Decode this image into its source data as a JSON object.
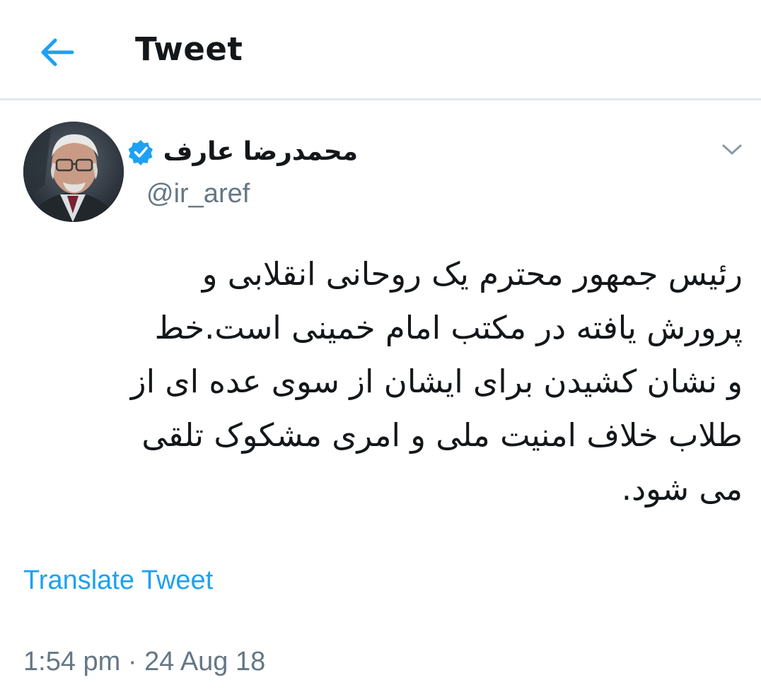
{
  "header": {
    "title": "Tweet",
    "back_icon": "arrow-left-icon",
    "accent_color": "#1da1f2"
  },
  "tweet": {
    "author": {
      "display_name": "محمدرضا عارف",
      "handle": "@ir_aref",
      "verified": true,
      "verified_icon": "verified-badge-icon"
    },
    "menu_icon": "chevron-down-icon",
    "text_lines": [
      "رئیس جمهور محترم یک روحانی انقلابی و",
      "پرورش یافته در مکتب امام خمینی است.خط",
      "و نشان کشیدن برای ایشان از سوی عده ای از",
      "طلاب خلاف امنیت ملی و امری مشکوک تلقی",
      "می شود."
    ],
    "translate_label": "Translate Tweet",
    "time": "1:54 pm",
    "separator": " · ",
    "date": "24 Aug 18"
  }
}
